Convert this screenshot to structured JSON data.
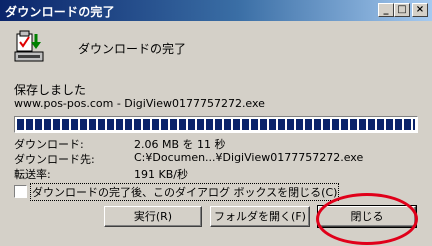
{
  "window": {
    "title": "ダウンロードの完了"
  },
  "titlebar_buttons": {
    "minimize": "_",
    "maximize": "□",
    "close": "×"
  },
  "header": {
    "title": "ダウンロードの完了",
    "icon": "download-complete-icon"
  },
  "status": "保存しました",
  "filename": "www.pos-pos.com - DigiView0177757272.exe",
  "progress": {
    "percent": 100
  },
  "info": {
    "downloaded_label": "ダウンロード:",
    "downloaded_value": "2.06 MB を 11 秒",
    "destination_label": "ダウンロード先:",
    "destination_value": "C:¥Documen...¥DigiView0177757272.exe",
    "rate_label": "転送率:",
    "rate_value": "191 KB/秒"
  },
  "checkbox": {
    "label": "ダウンロードの完了後、このダイアログ ボックスを閉じる(C)",
    "checked": false
  },
  "buttons": {
    "open": "実行(R)",
    "open_folder": "フォルダを開く(F)",
    "close": "閉じる"
  },
  "annotation": {
    "color": "#e0001a"
  }
}
